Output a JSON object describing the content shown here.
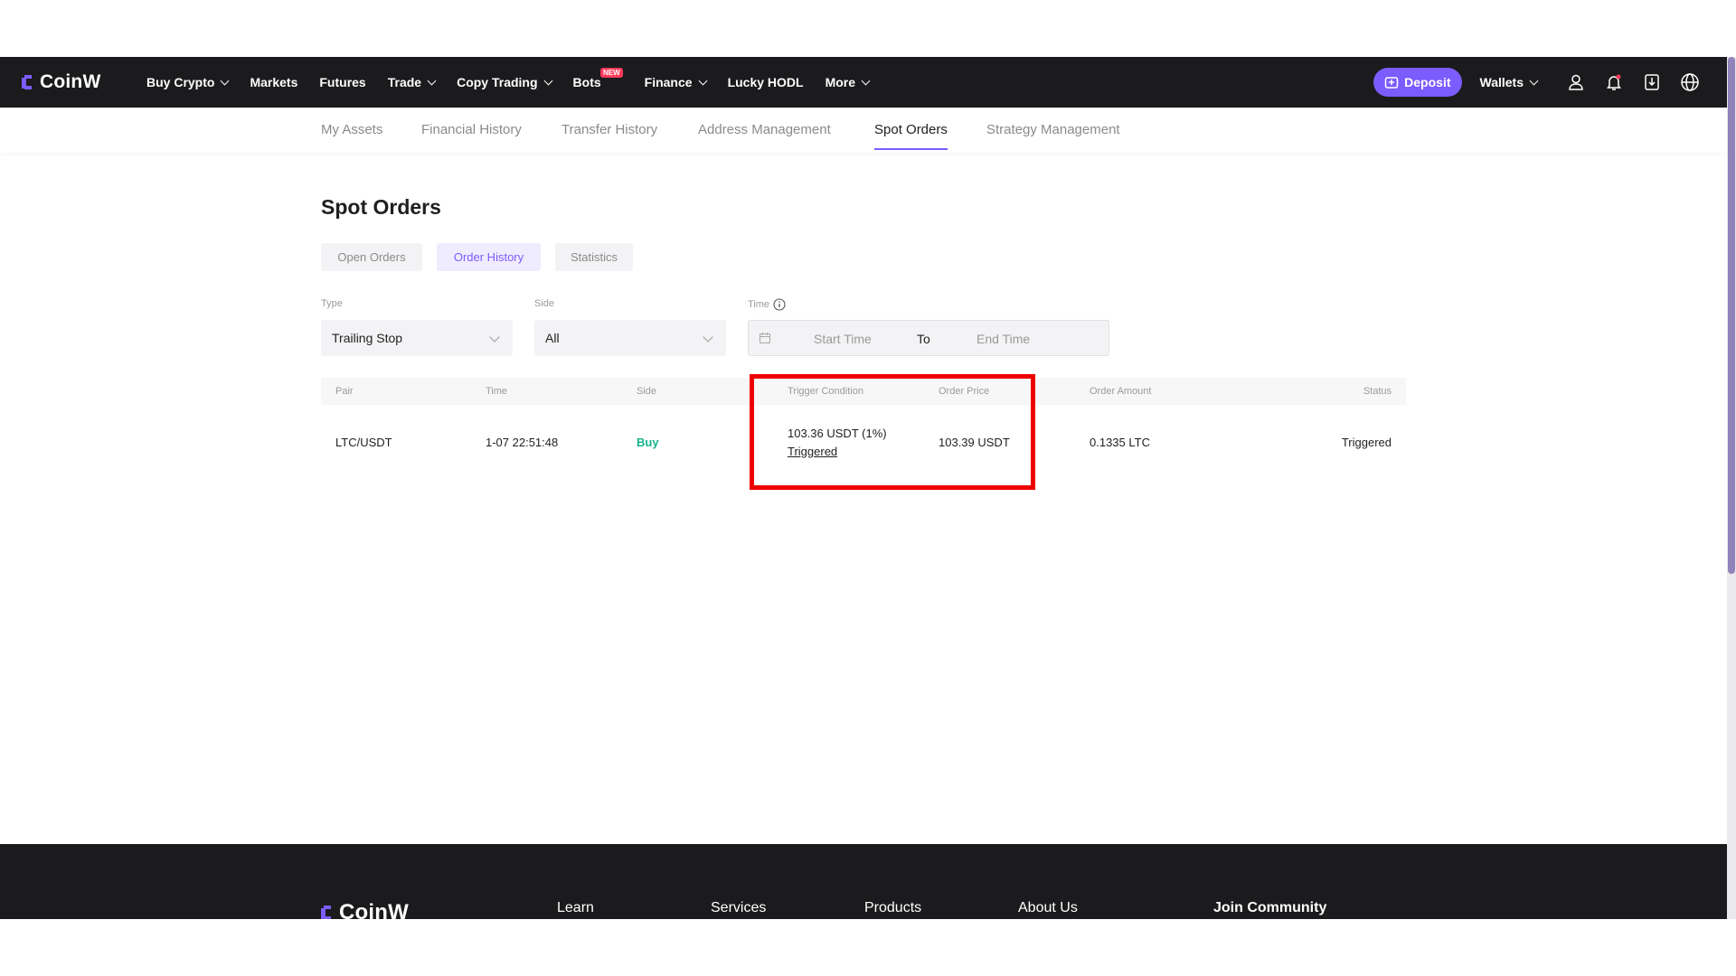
{
  "brand": {
    "name": "CoinW"
  },
  "nav": {
    "items": [
      {
        "label": "Buy Crypto",
        "dropdown": true
      },
      {
        "label": "Markets",
        "dropdown": false
      },
      {
        "label": "Futures",
        "dropdown": false
      },
      {
        "label": "Trade",
        "dropdown": true
      },
      {
        "label": "Copy Trading",
        "dropdown": true
      },
      {
        "label": "Bots",
        "badge": "NEW",
        "dropdown": false
      },
      {
        "label": "Finance",
        "dropdown": true
      },
      {
        "label": "Lucky HODL",
        "dropdown": false
      },
      {
        "label": "More",
        "dropdown": true
      }
    ],
    "deposit_label": "Deposit",
    "wallets_label": "Wallets"
  },
  "subnav": {
    "tabs": [
      {
        "label": "My Assets",
        "active": false
      },
      {
        "label": "Financial History",
        "active": false
      },
      {
        "label": "Transfer History",
        "active": false
      },
      {
        "label": "Address Management",
        "active": false
      },
      {
        "label": "Spot Orders",
        "active": true
      },
      {
        "label": "Strategy Management",
        "active": false
      }
    ]
  },
  "page": {
    "title": "Spot Orders",
    "pills": [
      {
        "label": "Open Orders",
        "active": false
      },
      {
        "label": "Order History",
        "active": true
      },
      {
        "label": "Statistics",
        "active": false
      }
    ]
  },
  "filters": {
    "type_label": "Type",
    "type_value": "Trailing Stop",
    "side_label": "Side",
    "side_value": "All",
    "time_label": "Time",
    "start_placeholder": "Start Time",
    "to_label": "To",
    "end_placeholder": "End Time"
  },
  "table": {
    "headers": {
      "pair": "Pair",
      "time": "Time",
      "side": "Side",
      "trigger": "Trigger Condition",
      "order_price": "Order Price",
      "order_amount": "Order Amount",
      "status": "Status"
    },
    "rows": [
      {
        "pair": "LTC/USDT",
        "time": "1-07 22:51:48",
        "side": "Buy",
        "trigger": "103.36 USDT (1%)",
        "trigger_status": "Triggered",
        "order_price": "103.39 USDT",
        "order_amount": "0.1335 LTC",
        "status": "Triggered"
      }
    ]
  },
  "footer": {
    "logo": "CoinW",
    "columns": [
      "Learn",
      "Services",
      "Products",
      "About Us",
      "Join Community"
    ]
  },
  "colors": {
    "accent": "#7b5cff",
    "buy": "#16b58f",
    "nav_bg": "#1b1b1d",
    "highlight": "#ee0000"
  }
}
